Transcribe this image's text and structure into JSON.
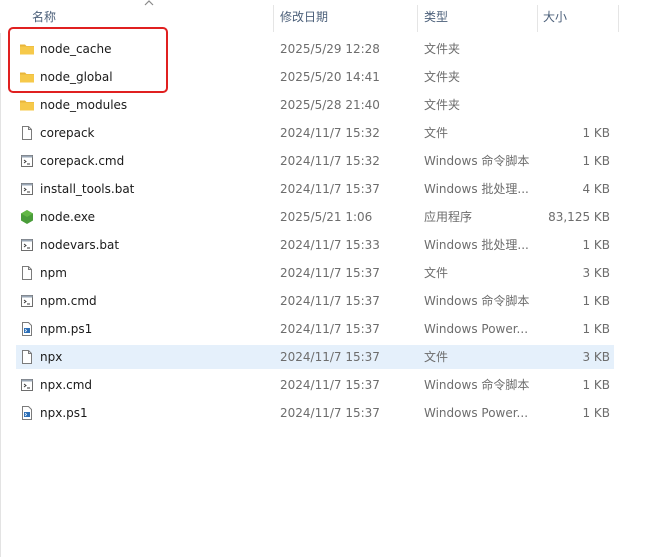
{
  "columns": {
    "name": "名称",
    "date": "修改日期",
    "type": "类型",
    "size": "大小"
  },
  "colors": {
    "folder": "#f6c94a",
    "selection": "#e5f0fb",
    "highlight_box": "#e02020",
    "node_icon": "#4a9d3a"
  },
  "files": [
    {
      "name": "node_cache",
      "date": "2025/5/29 12:28",
      "type": "文件夹",
      "size": "",
      "icon": "folder-icon"
    },
    {
      "name": "node_global",
      "date": "2025/5/20 14:41",
      "type": "文件夹",
      "size": "",
      "icon": "folder-icon"
    },
    {
      "name": "node_modules",
      "date": "2025/5/28 21:40",
      "type": "文件夹",
      "size": "",
      "icon": "folder-icon"
    },
    {
      "name": "corepack",
      "date": "2024/11/7 15:32",
      "type": "文件",
      "size": "1 KB",
      "icon": "file-icon"
    },
    {
      "name": "corepack.cmd",
      "date": "2024/11/7 15:32",
      "type": "Windows 命令脚本",
      "size": "1 KB",
      "icon": "script-icon"
    },
    {
      "name": "install_tools.bat",
      "date": "2024/11/7 15:37",
      "type": "Windows 批处理...",
      "size": "4 KB",
      "icon": "script-icon"
    },
    {
      "name": "node.exe",
      "date": "2025/5/21 1:06",
      "type": "应用程序",
      "size": "83,125 KB",
      "icon": "nodejs-icon"
    },
    {
      "name": "nodevars.bat",
      "date": "2024/11/7 15:33",
      "type": "Windows 批处理...",
      "size": "1 KB",
      "icon": "script-icon"
    },
    {
      "name": "npm",
      "date": "2024/11/7 15:37",
      "type": "文件",
      "size": "3 KB",
      "icon": "file-icon"
    },
    {
      "name": "npm.cmd",
      "date": "2024/11/7 15:37",
      "type": "Windows 命令脚本",
      "size": "1 KB",
      "icon": "script-icon"
    },
    {
      "name": "npm.ps1",
      "date": "2024/11/7 15:37",
      "type": "Windows Power...",
      "size": "1 KB",
      "icon": "powershell-icon"
    },
    {
      "name": "npx",
      "date": "2024/11/7 15:37",
      "type": "文件",
      "size": "3 KB",
      "icon": "file-icon",
      "selected": true
    },
    {
      "name": "npx.cmd",
      "date": "2024/11/7 15:37",
      "type": "Windows 命令脚本",
      "size": "1 KB",
      "icon": "script-icon"
    },
    {
      "name": "npx.ps1",
      "date": "2024/11/7 15:37",
      "type": "Windows Power...",
      "size": "1 KB",
      "icon": "powershell-icon"
    }
  ]
}
